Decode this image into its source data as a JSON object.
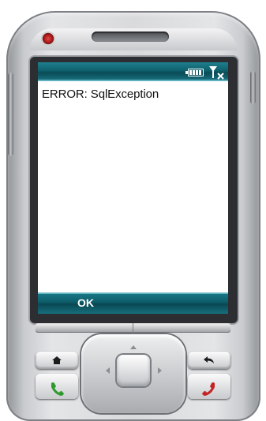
{
  "screen": {
    "message": "ERROR: SqlException",
    "softkey_left": "OK"
  },
  "status_icons": [
    "battery-icon",
    "signal-icon"
  ],
  "hardware_keys": [
    "home-icon",
    "back-icon",
    "call-icon",
    "end-call-icon",
    "dpad"
  ],
  "colors": {
    "title_bar": "#0e5f6c",
    "softkey_bar": "#0d5d6a",
    "camera_led": "#b21d1d",
    "call_green": "#2e9a2e",
    "end_red": "#c42424"
  }
}
